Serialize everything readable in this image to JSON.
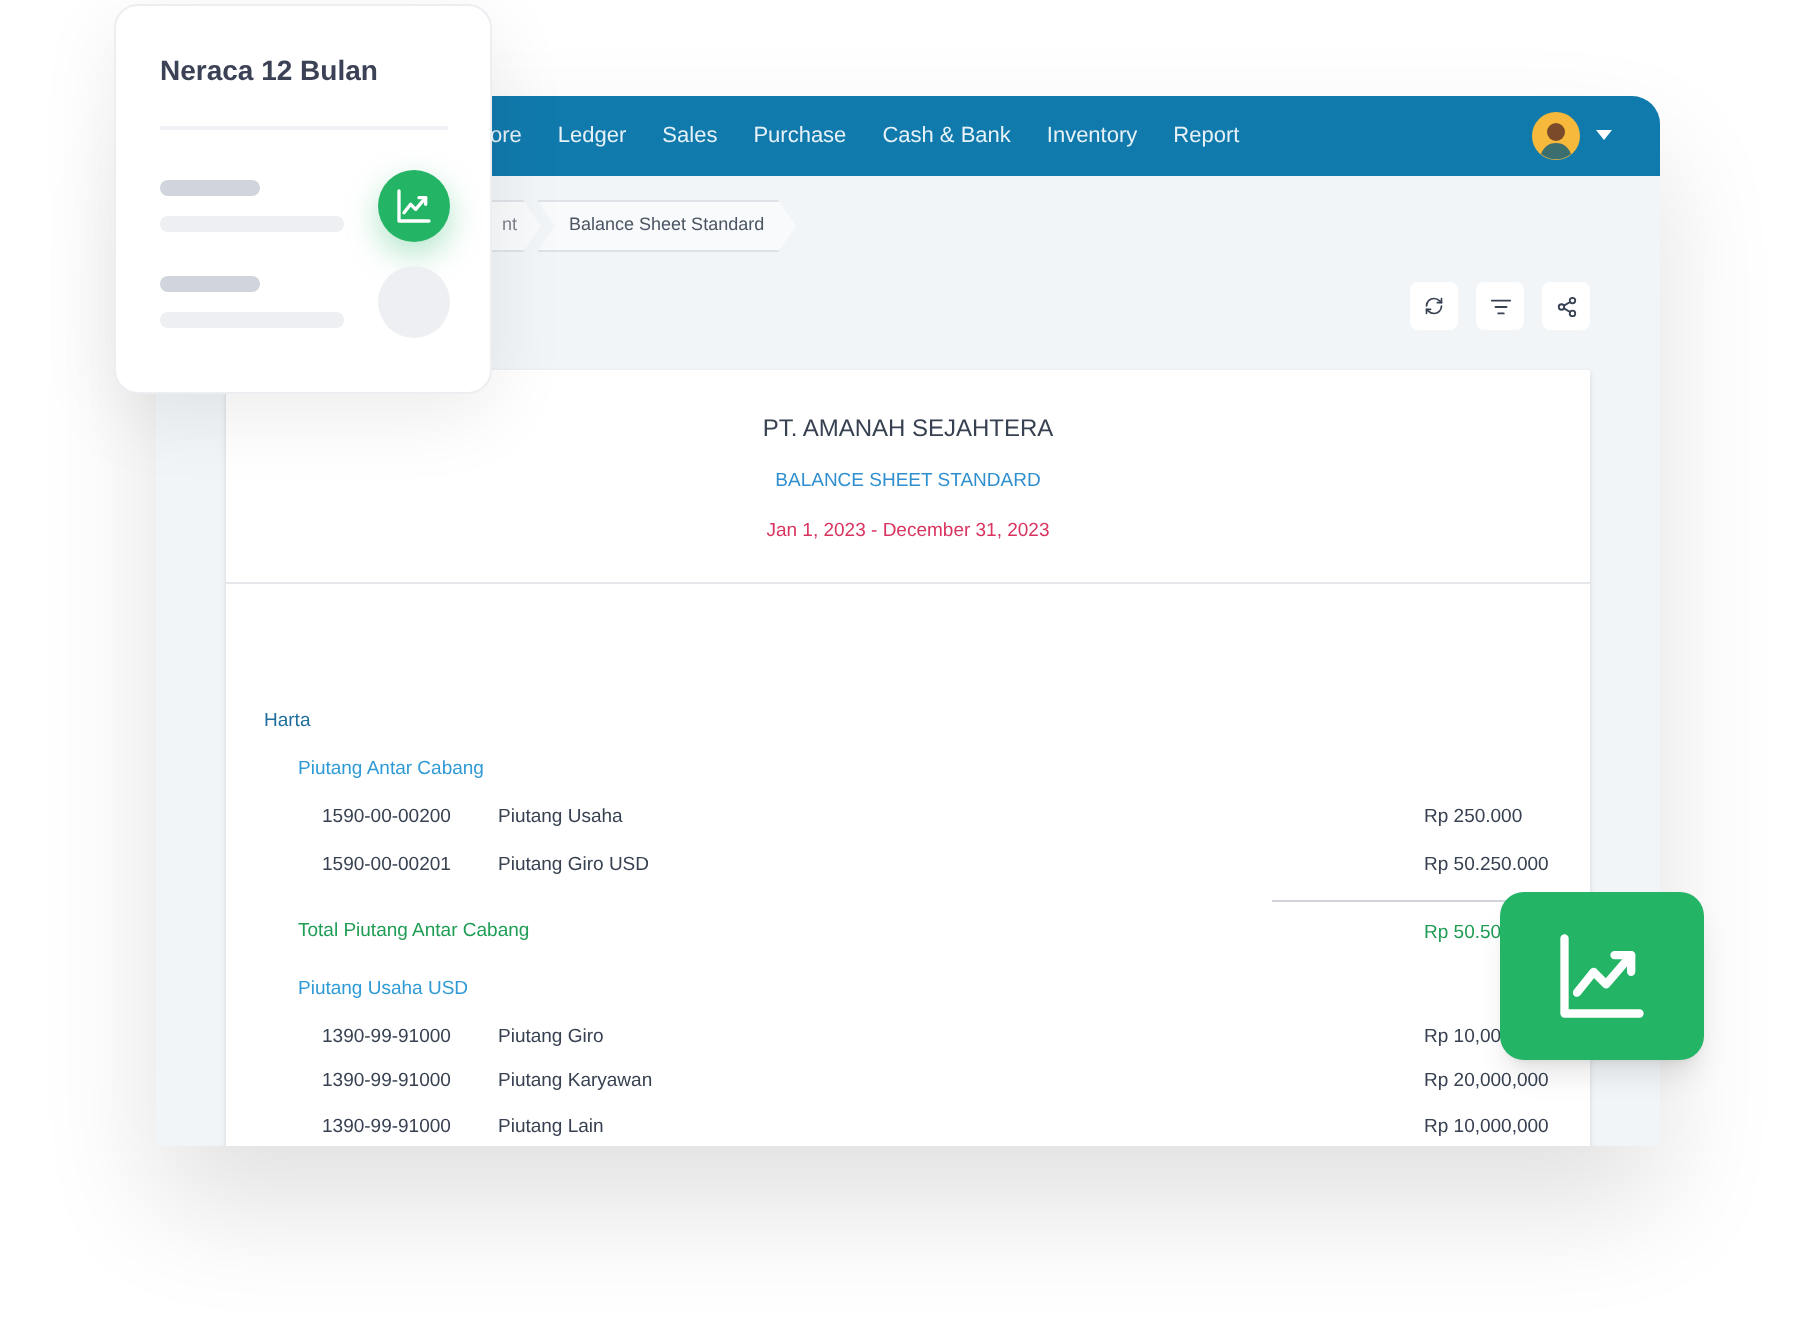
{
  "card": {
    "title": "Neraca 12 Bulan"
  },
  "nav": {
    "items": [
      "ore",
      "Ledger",
      "Sales",
      "Purchase",
      "Cash & Bank",
      "Inventory",
      "Report"
    ]
  },
  "breadcrumb": [
    "nt",
    "Balance Sheet Standard"
  ],
  "report": {
    "company": "PT. AMANAH SEJAHTERA",
    "title": "BALANCE SHEET STANDARD",
    "period": "Jan 1, 2023 - December 31, 2023",
    "sections": [
      {
        "heading": "Harta",
        "groups": [
          {
            "name": "Piutang Antar Cabang",
            "rows": [
              {
                "code": "1590-00-00200",
                "name": "Piutang Usaha",
                "amount": "Rp 250.000"
              },
              {
                "code": "1590-00-00201",
                "name": "Piutang Giro USD",
                "amount": "Rp 50.250.000"
              }
            ],
            "total": {
              "label": "Total Piutang Antar Cabang",
              "amount": "Rp 50.50"
            }
          },
          {
            "name": "Piutang Usaha USD",
            "rows": [
              {
                "code": "1390-99-91000",
                "name": "Piutang Giro",
                "amount": "Rp 10,00"
              },
              {
                "code": "1390-99-91000",
                "name": "Piutang Karyawan",
                "amount": "Rp 20,000,000"
              },
              {
                "code": "1390-99-91000",
                "name": "Piutang Lain",
                "amount": "Rp 10,000,000"
              }
            ]
          }
        ]
      }
    ]
  }
}
